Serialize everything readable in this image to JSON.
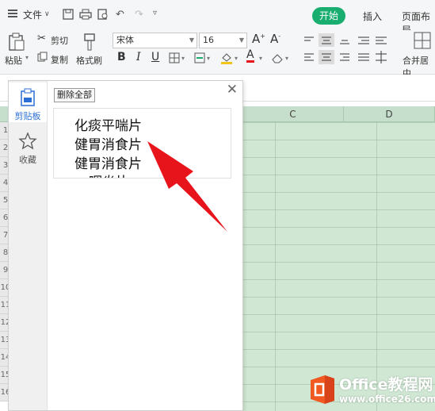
{
  "title_bar": {
    "file_menu": "文件",
    "tabs": [
      "开始",
      "插入",
      "页面布局"
    ]
  },
  "ribbon": {
    "paste": "粘贴",
    "cut": "剪切",
    "copy": "复制",
    "format_painter": "格式刷",
    "font_name": "宋体",
    "font_size": "16",
    "merge_center": "合并居中"
  },
  "columns": [
    "C",
    "D"
  ],
  "row_numbers": [
    "1",
    "2",
    "3",
    "4",
    "5",
    "6",
    "7",
    "8",
    "9",
    "10",
    "11",
    "12",
    "13",
    "14",
    "15",
    "16"
  ],
  "clipboard_panel": {
    "sidebar": [
      {
        "label": "剪贴板",
        "icon": "clipboard-icon",
        "active": true
      },
      {
        "label": "收藏",
        "icon": "star-icon",
        "active": false
      }
    ],
    "delete_all": "删除全部",
    "item_lines": [
      "化痰平喘片",
      "健胃消食片",
      "健胃消食片",
      "咽炎片"
    ]
  },
  "watermark": {
    "title": "Office教程网",
    "url": "www.office26.com"
  },
  "colors": {
    "start_tab": "#1aad70",
    "sheet_bg": "#cfe7d3",
    "arrow": "#e8141b",
    "logo_orange": "#f05a22"
  }
}
